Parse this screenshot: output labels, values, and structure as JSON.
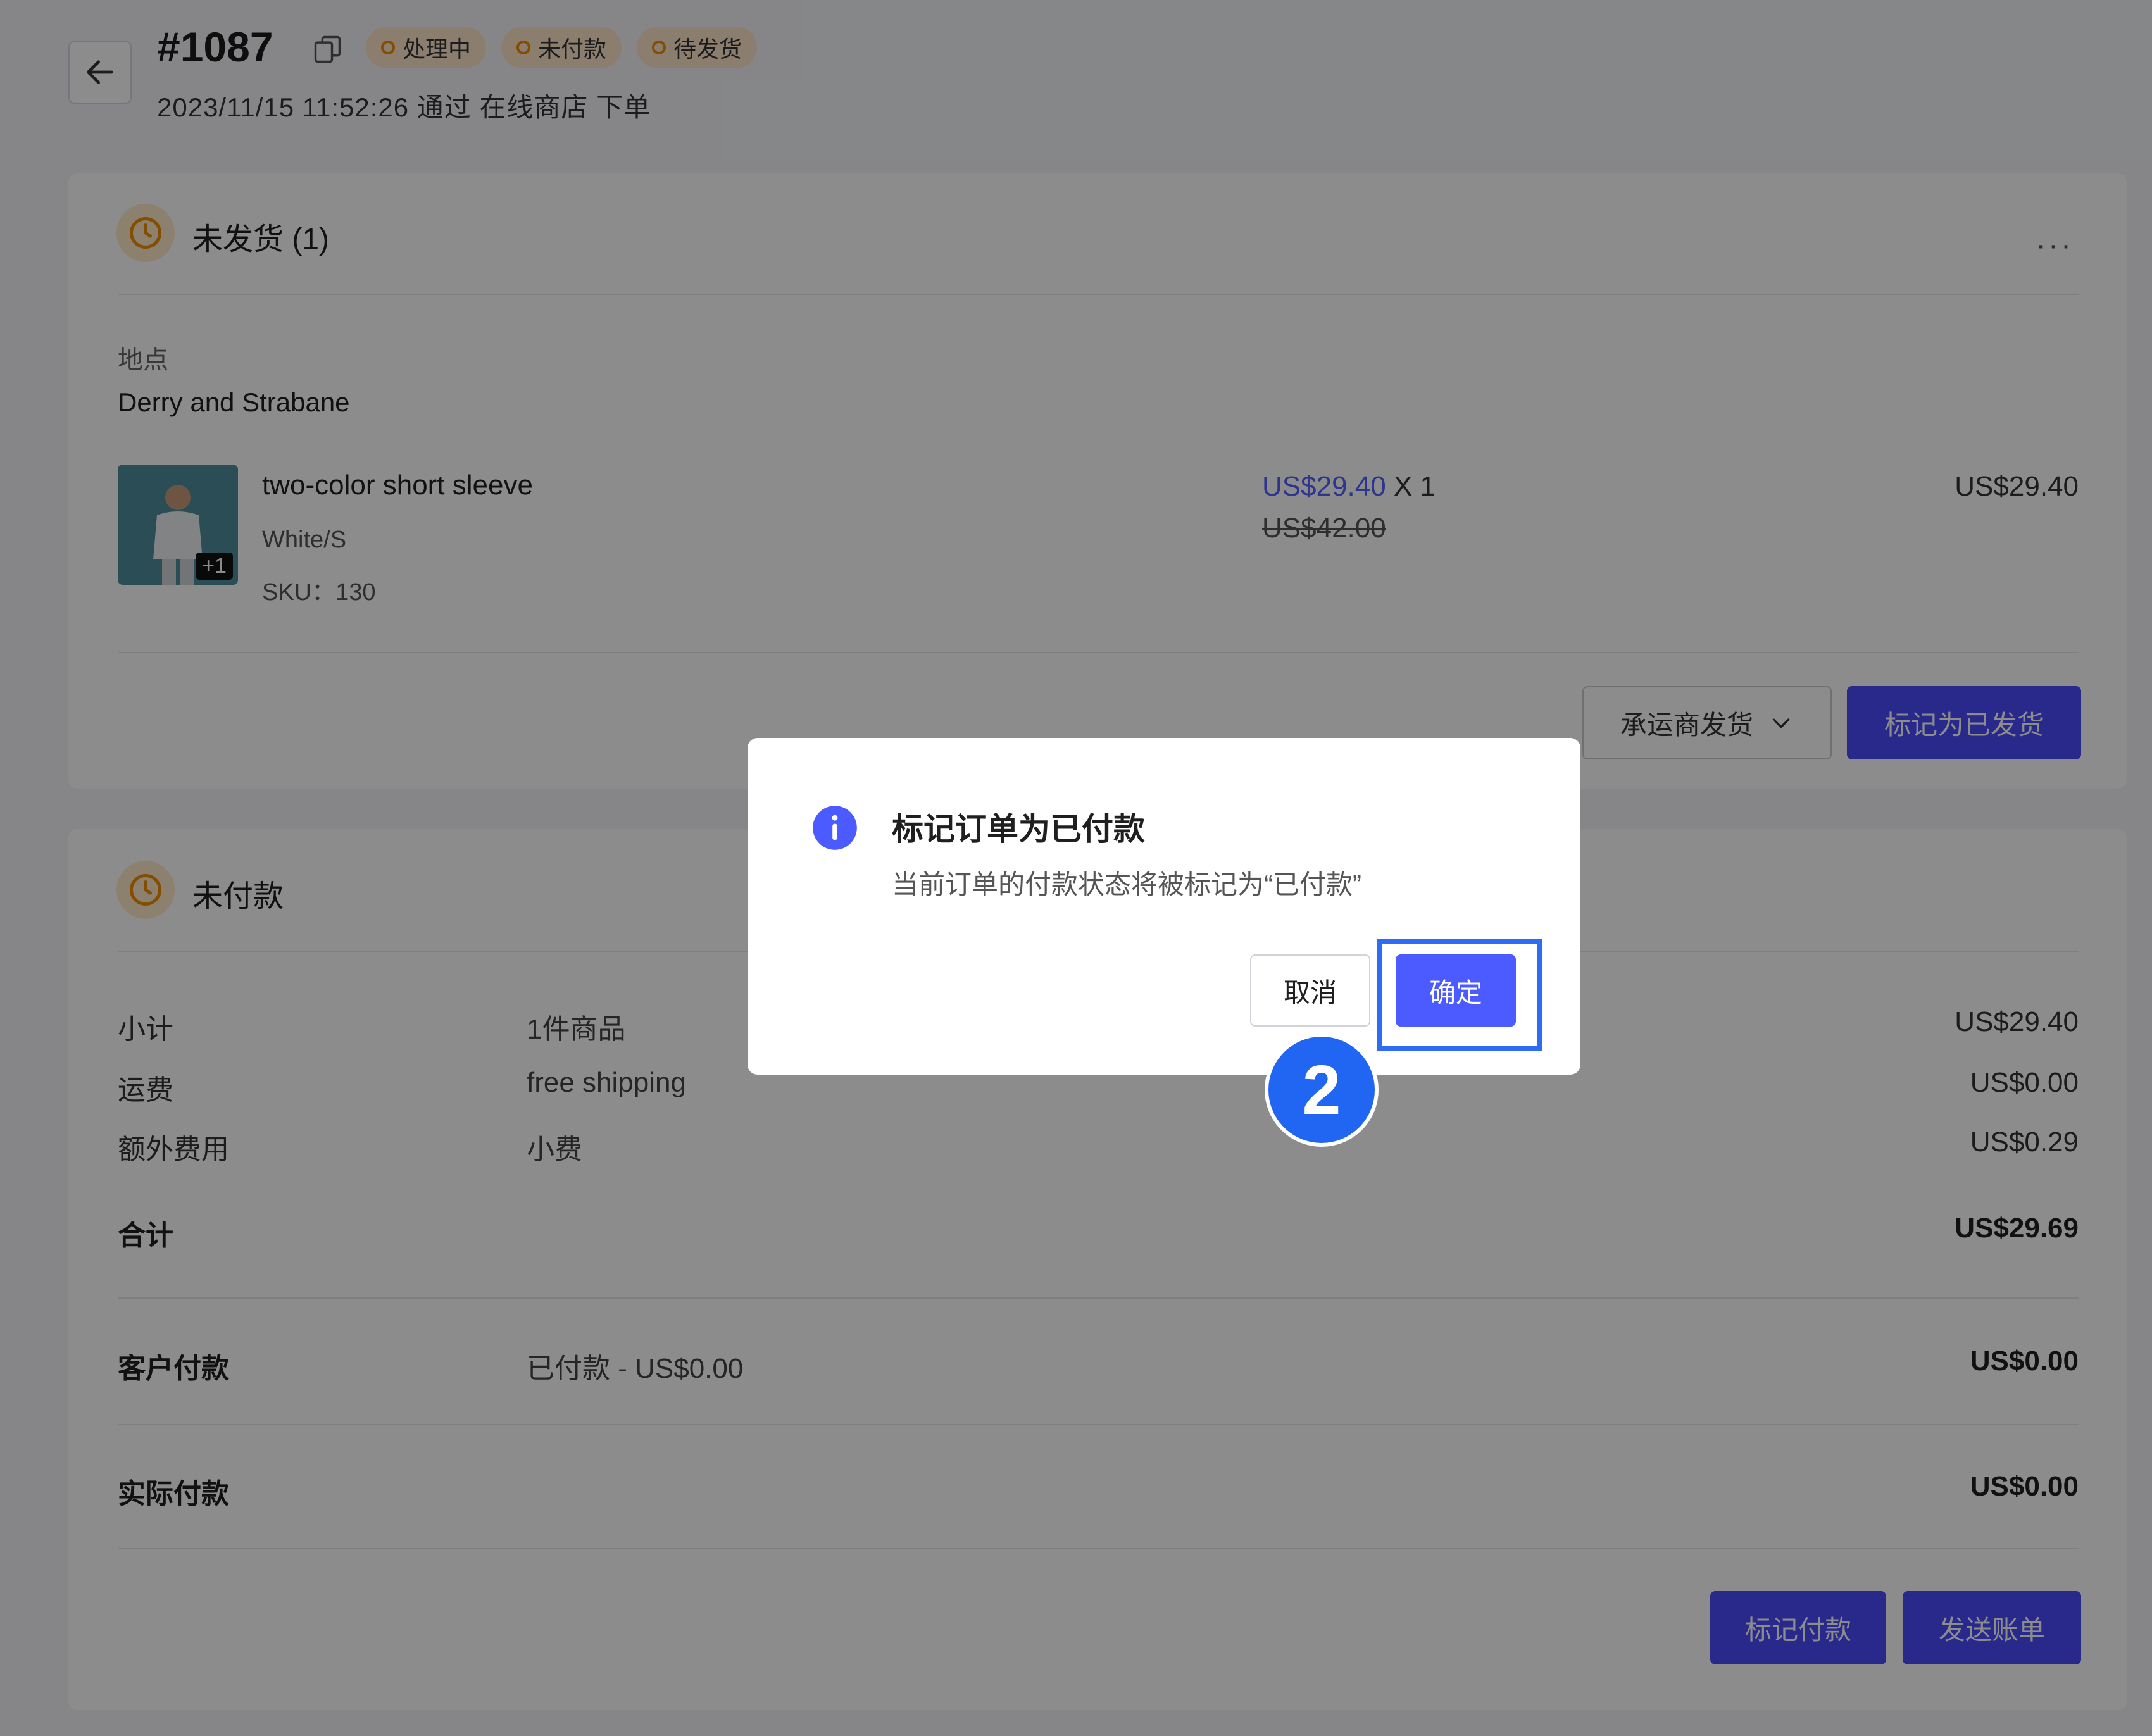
{
  "header": {
    "order_number": "#1087",
    "badges": [
      "处理中",
      "未付款",
      "待发货"
    ],
    "meta": "2023/11/15 11:52:26 通过 在线商店 下单"
  },
  "fulfillment": {
    "title": "未发货 (1)",
    "location_label": "地点",
    "location_value": "Derry and Strabane",
    "item": {
      "image_count": "+1",
      "name": "two-color short sleeve",
      "variant": "White/S",
      "sku": "SKU：130",
      "price": "US$29.40",
      "qty": "X 1",
      "original_price": "US$42.00",
      "total": "US$29.40"
    },
    "carrier_button": "承运商发货",
    "mark_shipped_button": "标记为已发货"
  },
  "payment": {
    "title": "未付款",
    "rows": [
      {
        "label": "小计",
        "mid": "1件商品",
        "value": "US$29.40"
      },
      {
        "label": "运费",
        "mid": "free shipping",
        "value": "US$0.00"
      },
      {
        "label": "额外费用",
        "mid": "小费",
        "value": "US$0.29"
      }
    ],
    "total_label": "合计",
    "total_value": "US$29.69",
    "customer_paid_label": "客户付款",
    "customer_paid_mid": "已付款 - US$0.00",
    "customer_paid_value": "US$0.00",
    "actual_paid_label": "实际付款",
    "actual_paid_value": "US$0.00",
    "mark_paid_button": "标记付款",
    "send_invoice_button": "发送账单"
  },
  "modal": {
    "title": "标记订单为已付款",
    "description": "当前订单的付款状态将被标记为“已付款”",
    "cancel": "取消",
    "confirm": "确定"
  },
  "step_marker": "2",
  "colors": {
    "primary": "#4b4bff",
    "accent_blue": "#2f6cf6",
    "badge_bg": "#fde6c8",
    "warning_orange": "#f08c00"
  }
}
